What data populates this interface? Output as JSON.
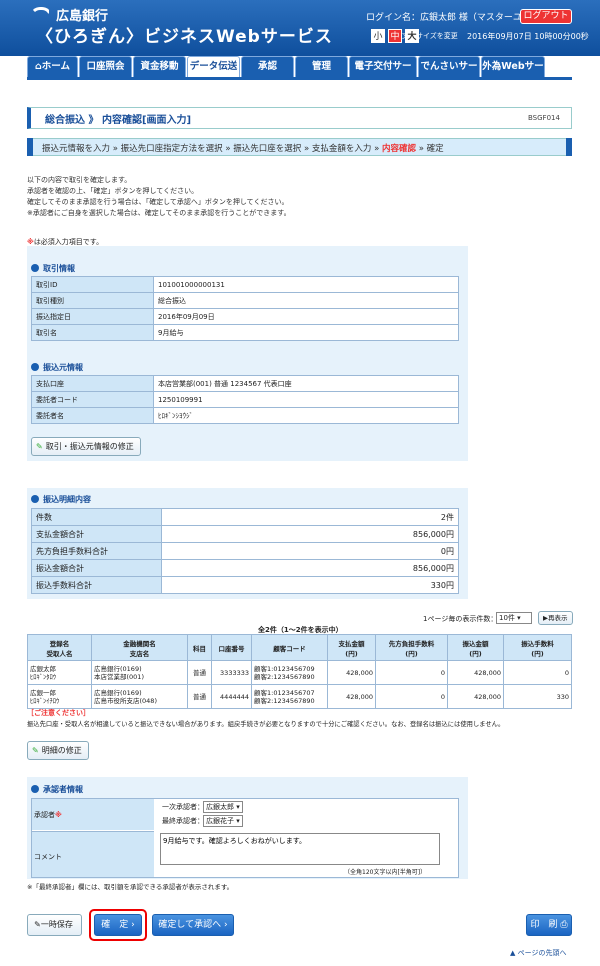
{
  "header": {
    "bank": "広島銀行",
    "service": "〈ひろぎん〉ビジネスWebサービス",
    "login": "ログイン名：広銀太郎 様（マスターユーザ）",
    "logout": "ログアウト",
    "font_size_label": "文字サイズを変更",
    "fs_small": "小",
    "fs_mid": "中",
    "fs_large": "大",
    "datetime": "2016年09月07日 10時00分00秒"
  },
  "nav": [
    "ホーム",
    "口座照会",
    "資金移動",
    "データ伝送",
    "承認",
    "管理",
    "電子交付サービス",
    "でんさいサービス",
    "外為Webサービス"
  ],
  "page": {
    "title": "総合振込 》 内容確認[画面入力]",
    "screen_id": "BSGF014"
  },
  "steps": {
    "s1": "振込元情報を入力",
    "s2": "振込先口座指定方法を選択",
    "s3": "振込先口座を選択",
    "s4": "支払金額を入力",
    "s5": "内容確認",
    "s6": "確定"
  },
  "intro": [
    "以下の内容で取引を確定します。",
    "承認者を確認の上、「確定」ボタンを押してください。",
    "確定してそのまま承認を行う場合は、「確定して承認へ」ボタンを押してください。",
    "※承認者にご自身を選択した場合は、確定してそのまま承認を行うことができます。"
  ],
  "required_note": {
    "mark": "※",
    "text": "は必須入力項目です。"
  },
  "trade_info": {
    "heading": "取引情報",
    "rows": [
      {
        "k": "取引ID",
        "v": "101001000000131"
      },
      {
        "k": "取引種別",
        "v": "総合振込"
      },
      {
        "k": "振込指定日",
        "v": "2016年09月09日"
      },
      {
        "k": "取引名",
        "v": "9月給与"
      }
    ]
  },
  "source_info": {
    "heading": "振込元情報",
    "rows": [
      {
        "k": "支払口座",
        "v": "本店営業部(001) 普通 1234567 代表口座"
      },
      {
        "k": "委託者コード",
        "v": "1250109991"
      },
      {
        "k": "委託者名",
        "v": "ﾋﾛｷﾞﾝｼﾖｳｼﾞ"
      }
    ]
  },
  "fix_source_btn": "取引・振込元情報の修正",
  "detail_summary": {
    "heading": "振込明細内容",
    "rows": [
      {
        "k": "件数",
        "v": "2件"
      },
      {
        "k": "支払金額合計",
        "v": "856,000円"
      },
      {
        "k": "先方負担手数料合計",
        "v": "0円"
      },
      {
        "k": "振込金額合計",
        "v": "856,000円"
      },
      {
        "k": "振込手数料合計",
        "v": "330円"
      }
    ]
  },
  "table": {
    "per_page_label": "1ページ毎の表示件数：",
    "per_page": "10件",
    "redisplay": "再表示",
    "count": "全2件（1～2件を表示中）",
    "headers": [
      "登録名\n受取人名",
      "金融機関名\n支店名",
      "科目",
      "口座番号",
      "顧客コード",
      "支払金額\n(円)",
      "先方負担手数料\n(円)",
      "振込金額\n(円)",
      "振込手数料\n(円)"
    ],
    "rows": [
      [
        "広銀太郎\nﾋﾛｷﾞﾝﾀﾛｳ",
        "広島銀行(0169)\n本店営業部(001)",
        "普通",
        "3333333",
        "顧客1:0123456709\n顧客2:1234567890",
        "428,000",
        "0",
        "428,000",
        "0"
      ],
      [
        "広銀一郎\nﾋﾛｷﾞﾝｲﾁﾛｳ",
        "広島銀行(0169)\n広島市役所支店(048)",
        "普通",
        "4444444",
        "顧客1:0123456707\n顧客2:1234567890",
        "428,000",
        "0",
        "428,000",
        "330"
      ]
    ]
  },
  "caution": {
    "title": "［ご注意ください］",
    "text": "振込先口座・受取人名が相違していると振込できない場合があります。組戻手続きが必要となりますので十分にご確認ください。なお、登録名は振込には使用しません。"
  },
  "fix_detail_btn": "明細の修正",
  "approver": {
    "heading": "承認者情報",
    "label": "承認者",
    "mark": "※",
    "first_label": "一次承認者：",
    "first_val": "広銀太郎",
    "final_label": "最終承認者：",
    "final_val": "広銀花子",
    "comment_label": "コメント",
    "comment": "9月給与です。確認よろしくおねがいします。",
    "comment_limit": "（全角120文字以内[半角可]）"
  },
  "approver_note": "※「最終承認者」欄には、取引額を承認できる承認者が表示されます。",
  "buttons": {
    "temp_save": "一時保存",
    "confirm": "確　定",
    "confirm_approve": "確定して承認へ",
    "print": "印　刷",
    "page_top": "ページの先頭へ"
  }
}
